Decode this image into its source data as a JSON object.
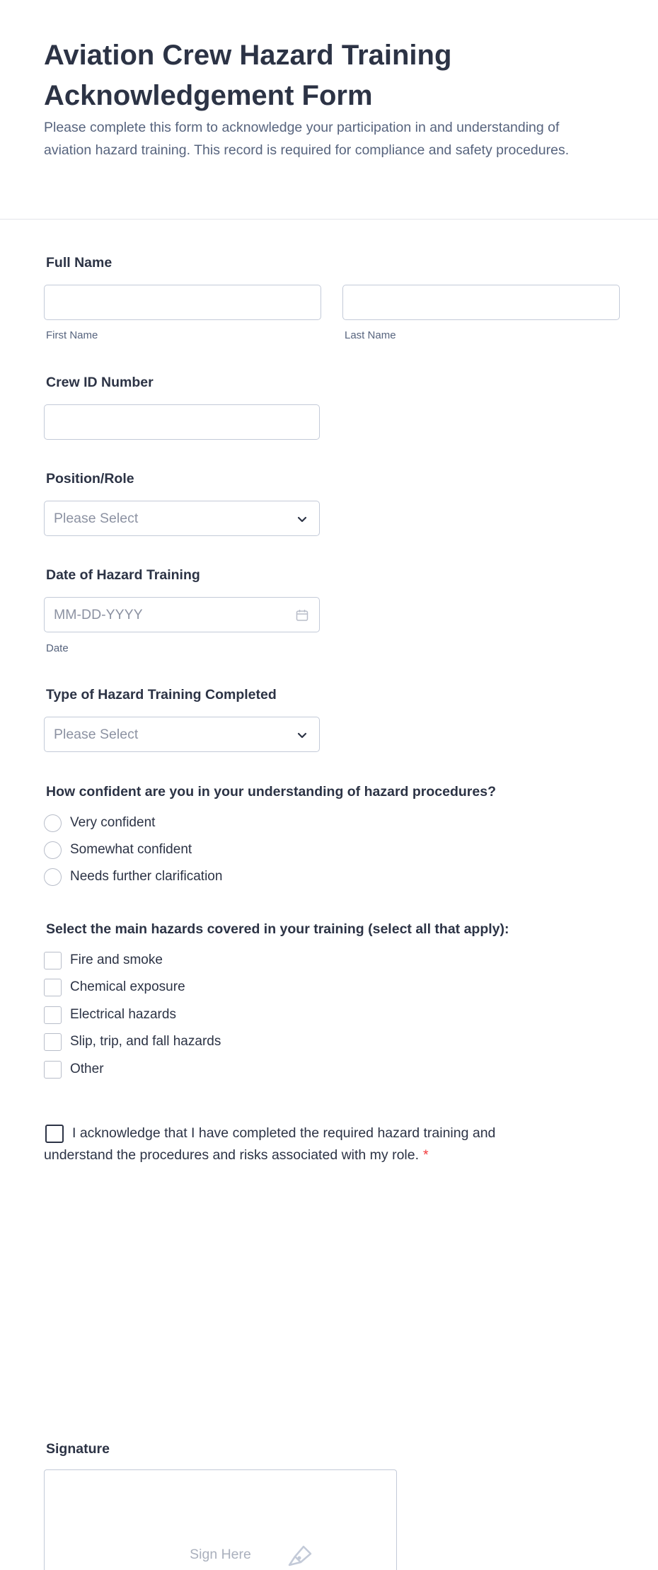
{
  "form": {
    "title": "Aviation Crew Hazard Training Acknowledgement Form",
    "description": "Please complete this form to acknowledge your participation in and understanding of aviation hazard training. This record is required for compliance and safety procedures."
  },
  "full_name": {
    "label": "Full Name",
    "first_sublabel": "First Name",
    "last_sublabel": "Last Name",
    "first_value": "",
    "last_value": ""
  },
  "crew_id": {
    "label": "Crew ID Number",
    "value": ""
  },
  "position": {
    "label": "Position/Role",
    "placeholder": "Please Select"
  },
  "training_date": {
    "label": "Date of Hazard Training",
    "placeholder": "MM-DD-YYYY",
    "sublabel": "Date"
  },
  "training_type": {
    "label": "Type of Hazard Training Completed",
    "placeholder": "Please Select"
  },
  "confidence": {
    "label": "How confident are you in your understanding of hazard procedures?",
    "options": [
      "Very confident",
      "Somewhat confident",
      "Needs further clarification"
    ]
  },
  "hazards": {
    "label": "Select the main hazards covered in your training (select all that apply):",
    "options": [
      "Fire and smoke",
      "Chemical exposure",
      "Electrical hazards",
      "Slip, trip, and fall hazards",
      "Other"
    ]
  },
  "acknowledgement": {
    "text": "I acknowledge that I have completed the required hazard training and understand the procedures and risks associated with my role.",
    "required_mark": "*"
  },
  "signature": {
    "label": "Signature",
    "pad_text": "Sign Here"
  },
  "icons": {
    "dropdown": "chevron-down-icon",
    "date": "calendar-icon",
    "signature": "pen-icon"
  },
  "colors": {
    "text": "#2c3345",
    "muted": "#57647e",
    "border": "#c3cad8",
    "required": "#f23a3c"
  }
}
